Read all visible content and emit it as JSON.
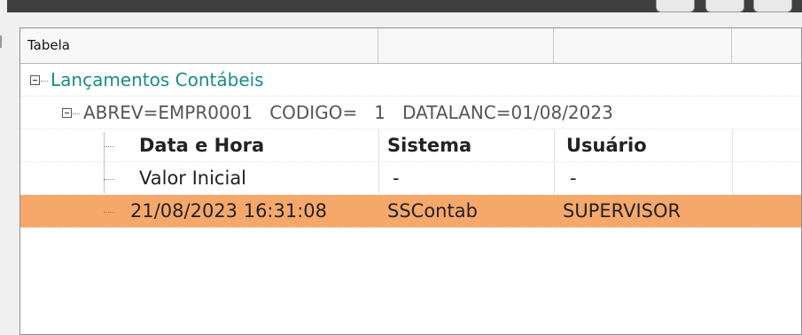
{
  "header": {
    "columns": [
      "Tabela",
      "",
      "",
      ""
    ]
  },
  "tree": {
    "root_label": "Lançamentos Contábeis",
    "record_label": "ABREV=EMPR0001   CODIGO=   1   DATALANC=01/08/2023",
    "columns_row": {
      "datetime": "Data e Hora",
      "system": "Sistema",
      "user": "Usuário"
    },
    "rows": [
      {
        "datetime": "Valor Inicial",
        "system": "-",
        "user": "-",
        "selected": false
      },
      {
        "datetime": "21/08/2023 16:31:08",
        "system": "SSContab",
        "user": "SUPERVISOR",
        "selected": true
      }
    ]
  },
  "colors": {
    "root_text": "#1a8a8a",
    "selection": "#f6a86b"
  }
}
